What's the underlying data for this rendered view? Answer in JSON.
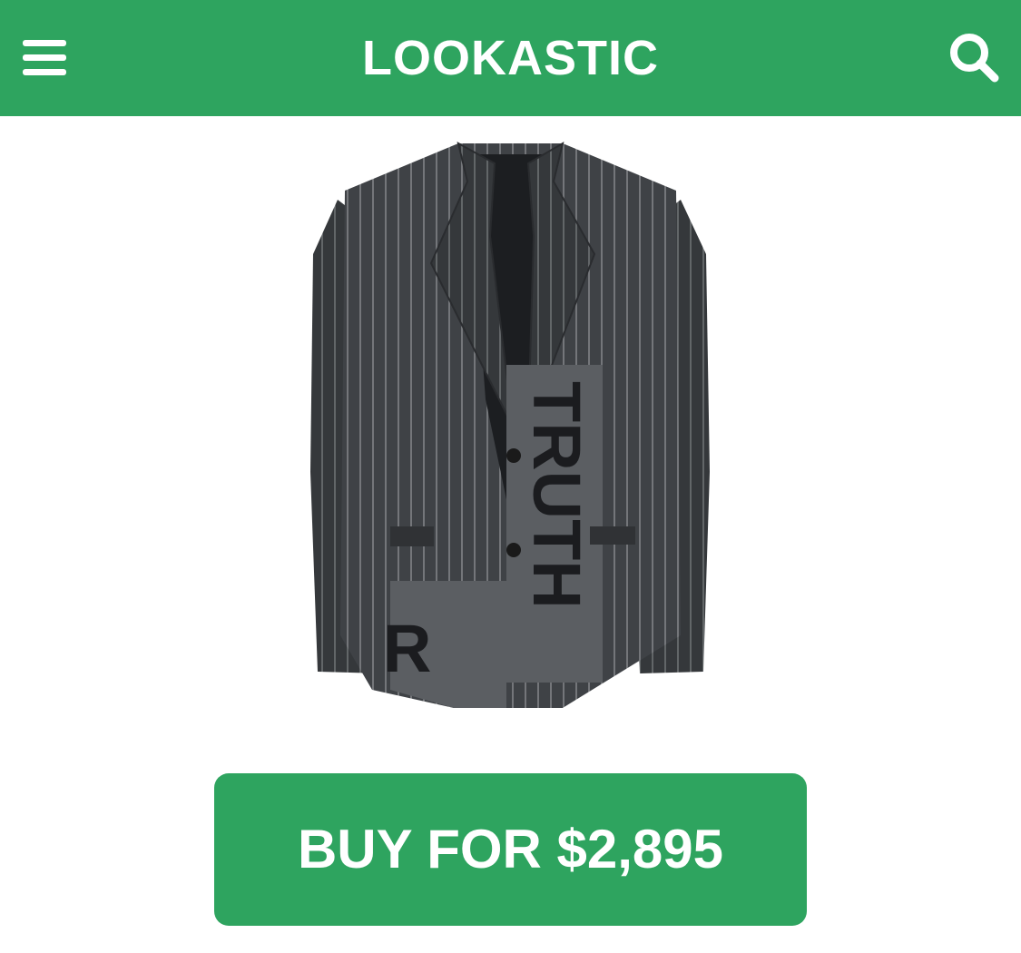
{
  "header": {
    "brand": "LOOKASTIC",
    "menu_icon": "hamburger-menu-icon",
    "search_icon": "search-icon",
    "bar_color": "#2ea45f"
  },
  "product": {
    "image_description_icon": "pinstripe-blazer-image",
    "jacket_print_text": "TRUTH"
  },
  "cta": {
    "buy_label": "BUY FOR $2,895",
    "button_color": "#2ea45f"
  }
}
